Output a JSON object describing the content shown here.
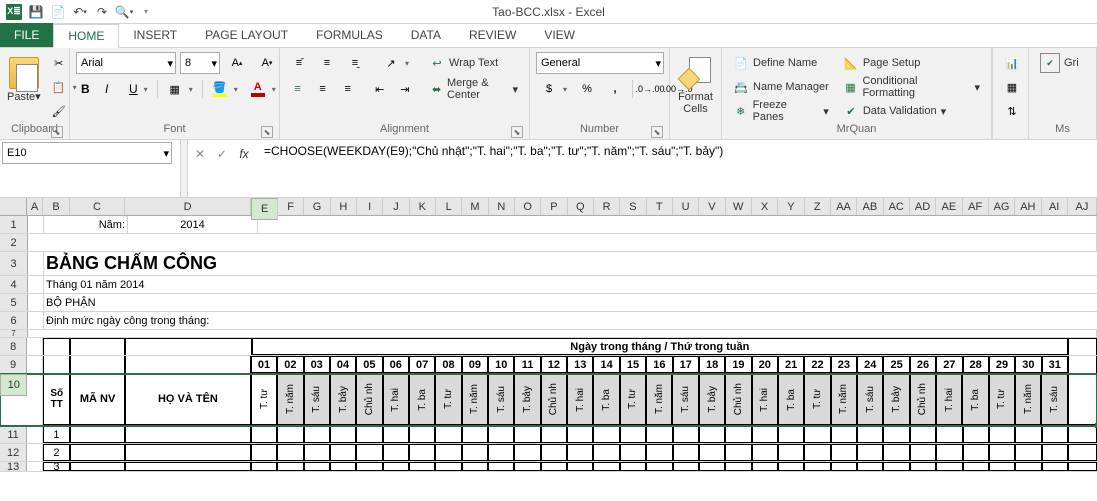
{
  "window": {
    "title": "Tao-BCC.xlsx - Excel"
  },
  "tabs": [
    "FILE",
    "HOME",
    "INSERT",
    "PAGE LAYOUT",
    "FORMULAS",
    "DATA",
    "REVIEW",
    "VIEW"
  ],
  "active_tab": "HOME",
  "ribbon": {
    "clipboard": {
      "label": "Clipboard",
      "paste": "Paste"
    },
    "font": {
      "label": "Font",
      "name": "Arial",
      "size": "8",
      "bold": "B",
      "italic": "I",
      "underline": "U"
    },
    "alignment": {
      "label": "Alignment",
      "wrap": "Wrap Text",
      "merge": "Merge & Center"
    },
    "number": {
      "label": "Number",
      "format": "General"
    },
    "cells": {
      "label": "",
      "format_cells": "Format\nCells"
    },
    "mrquan": {
      "label": "MrQuan",
      "define_name": "Define Name",
      "name_manager": "Name Manager",
      "freeze_panes": "Freeze Panes",
      "page_setup": "Page Setup",
      "conditional_formatting": "Conditional Formatting",
      "data_validation": "Data Validation"
    },
    "ms": {
      "label": "Ms",
      "gri": "Gri"
    }
  },
  "fx": {
    "cell_ref": "E10",
    "formula": "=CHOOSE(WEEKDAY(E9);\"Chủ nhật\";\"T. hai\";\"T. ba\";\"T. tư\";\"T. năm\";\"T. sáu\";\"T. bảy\")"
  },
  "cols": {
    "A": 16,
    "B": 28,
    "C": 56,
    "D": 130,
    "day_w": 27
  },
  "content": {
    "year_label": "Năm:",
    "year_value": "2014",
    "title": "BẢNG CHẤM CÔNG",
    "subtitle1": "Tháng 01 năm 2014",
    "subtitle2": "BỘ PHẬN",
    "subtitle3": "Định mức ngày công trong tháng:",
    "hdr_stt": "Số\nTT",
    "hdr_manv": "MÃ NV",
    "hdr_hoten": "HỌ VÀ TÊN",
    "hdr_days": "Ngày trong tháng / Thứ trong tuần",
    "day_nums": [
      "01",
      "02",
      "03",
      "04",
      "05",
      "06",
      "07",
      "08",
      "09",
      "10",
      "11",
      "12",
      "13",
      "14",
      "15",
      "16",
      "17",
      "18",
      "19",
      "20",
      "21",
      "22",
      "23",
      "24",
      "25",
      "26",
      "27",
      "28",
      "29",
      "30",
      "31"
    ],
    "day_wks": [
      "T. tư",
      "T. năm",
      "T. sáu",
      "T. bảy",
      "Chủ nh",
      "T. hai",
      "T. ba",
      "T. tư",
      "T. năm",
      "T. sáu",
      "T. bảy",
      "Chủ nh",
      "T. hai",
      "T. ba",
      "T. tư",
      "T. năm",
      "T. sáu",
      "T. bảy",
      "Chủ nh",
      "T. hai",
      "T. ba",
      "T. tư",
      "T. năm",
      "T. sáu",
      "T. bảy",
      "Chủ nh",
      "T. hai",
      "T. ba",
      "T. tư",
      "T. năm",
      "T. sáu"
    ],
    "day_letters": [
      "E",
      "F",
      "G",
      "H",
      "I",
      "J",
      "K",
      "L",
      "M",
      "N",
      "O",
      "P",
      "Q",
      "R",
      "S",
      "T",
      "U",
      "V",
      "W",
      "X",
      "Y",
      "Z",
      "AA",
      "AB",
      "AC",
      "AD",
      "AE",
      "AF",
      "AG",
      "AH",
      "AI"
    ],
    "row_nums": [
      "1",
      "2",
      "3"
    ]
  }
}
